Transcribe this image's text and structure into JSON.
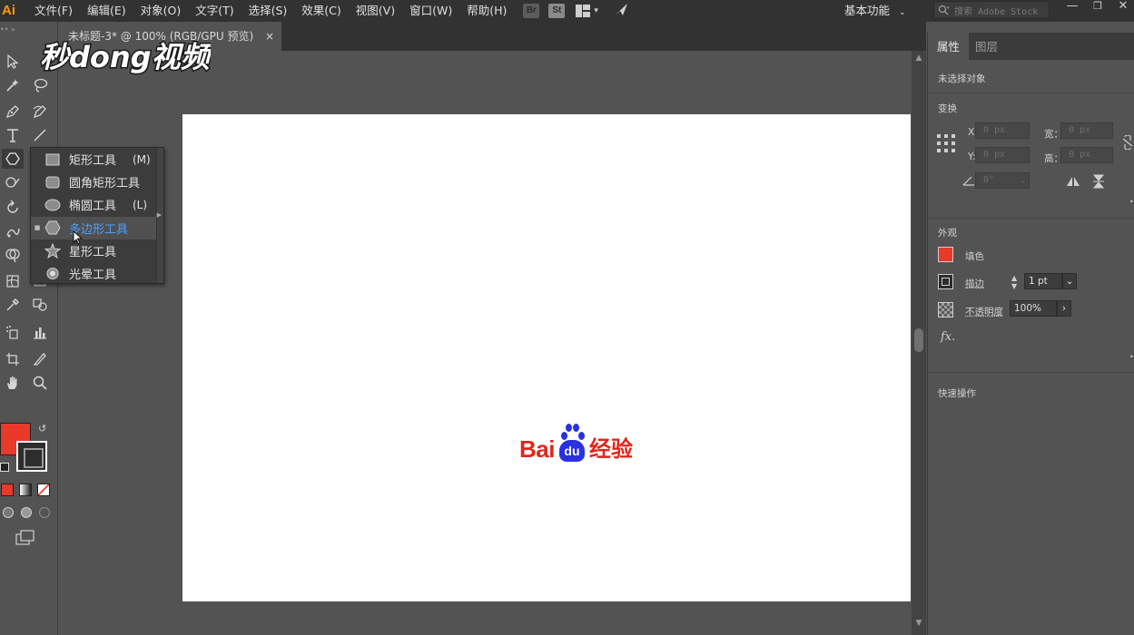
{
  "app": {
    "logo": "Ai",
    "menu": [
      "文件(F)",
      "编辑(E)",
      "对象(O)",
      "文字(T)",
      "选择(S)",
      "效果(C)",
      "视图(V)",
      "窗口(W)",
      "帮助(H)"
    ],
    "bridge_label": "Br",
    "stock_label": "St",
    "workspace": "基本功能",
    "stock_search_placeholder": "搜索 Adobe Stock"
  },
  "watermark": "秒dong视频",
  "document": {
    "tab_title": "未标题-3* @ 100% (RGB/GPU 预览)",
    "close_glyph": "×"
  },
  "canvas": {
    "logo_text_left": "Bai",
    "logo_text_paw": "du",
    "logo_text_right": "经验"
  },
  "flyout": {
    "items": [
      {
        "label": "矩形工具",
        "shortcut": "(M)",
        "icon": "rectangle-icon",
        "active": false
      },
      {
        "label": "圆角矩形工具",
        "shortcut": "",
        "icon": "rounded-rectangle-icon",
        "active": false
      },
      {
        "label": "椭圆工具",
        "shortcut": "(L)",
        "icon": "ellipse-icon",
        "active": false
      },
      {
        "label": "多边形工具",
        "shortcut": "",
        "icon": "polygon-icon",
        "active": true
      },
      {
        "label": "星形工具",
        "shortcut": "",
        "icon": "star-icon",
        "active": false
      },
      {
        "label": "光晕工具",
        "shortcut": "",
        "icon": "flare-icon",
        "active": false
      }
    ]
  },
  "colors": {
    "fill": "#e8392a",
    "accent_blue": "#4aa1ff",
    "baidu_red": "#e1251b",
    "baidu_blue": "#2932e1"
  },
  "properties_panel": {
    "tabs": [
      "属性",
      "图层"
    ],
    "no_selection": "未选择对象",
    "transform": {
      "title": "变换",
      "x_label": "X:",
      "y_label": "Y:",
      "w_label": "宽：",
      "h_label": "高：",
      "x_value": "0 px",
      "y_value": "0 px",
      "w_value": "0 px",
      "h_value": "0 px",
      "angle_value": "0°"
    },
    "appearance": {
      "title": "外观",
      "fill_label": "填色",
      "stroke_label": "描边",
      "stroke_value": "1 pt",
      "opacity_label": "不透明度",
      "opacity_value": "100%",
      "fx_label": "fx."
    },
    "quick_actions": "快速操作"
  }
}
